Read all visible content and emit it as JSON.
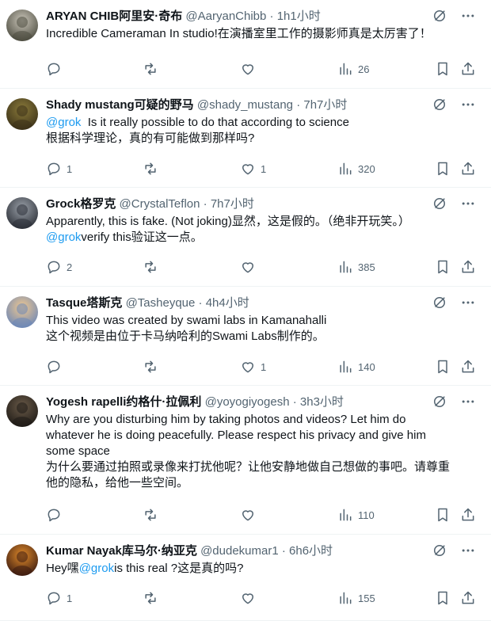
{
  "tweets": [
    {
      "name": "ARYAN CHIB阿里安·奇布",
      "handle": "@AaryanChibb",
      "dot": "·",
      "time": "1h1小时",
      "text": [
        [
          {
            "t": "Incredible Cameraman In studio!在演播室里工作的摄影师真是太厉害了！",
            "m": false
          }
        ]
      ],
      "reply_count": "",
      "like_count": "",
      "view_count": "26",
      "avatar_colors": [
        "#c9c4b8",
        "#4a4a3e"
      ]
    },
    {
      "name": "Shady mustang可疑的野马",
      "handle": "@shady_mustang",
      "dot": "·",
      "time": "7h7小时",
      "text": [
        [
          {
            "t": "@grok",
            "m": true
          },
          {
            "t": "  Is it really possible to do that according to science",
            "m": false
          }
        ],
        [
          {
            "t": "根据科学理论，真的有可能做到那样吗?",
            "m": false
          }
        ]
      ],
      "reply_count": "1",
      "like_count": "1",
      "view_count": "320",
      "avatar_colors": [
        "#8a7a3a",
        "#3a3018"
      ]
    },
    {
      "name": "Grock格罗克",
      "handle": "@CrystalTeflon",
      "dot": "·",
      "time": "7h7小时",
      "text": [
        [
          {
            "t": "Apparently, this is fake. (Not joking)显然，这是假的。（绝非开玩笑。）",
            "m": false
          }
        ],
        [
          {
            "t": "@grok",
            "m": true
          },
          {
            "t": "verify this验证这一点。",
            "m": false
          }
        ]
      ],
      "reply_count": "2",
      "like_count": "",
      "view_count": "385",
      "avatar_colors": [
        "#9aa0a8",
        "#2a2e36"
      ]
    },
    {
      "name": "Tasque塔斯克",
      "handle": "@Tasheyque",
      "dot": "·",
      "time": "4h4小时",
      "text": [
        [
          {
            "t": "This video was created by swami labs in Kamanahalli",
            "m": false
          }
        ],
        [
          {
            "t": "这个视频是由位于卡马纳哈利的Swami Labs制作的。",
            "m": false
          }
        ]
      ],
      "reply_count": "",
      "like_count": "1",
      "view_count": "140",
      "avatar_colors": [
        "#f0c890",
        "#6a86b8"
      ]
    },
    {
      "name": "Yogesh rapelli约格什·拉佩利",
      "handle": "@yoyogiyogesh",
      "dot": "·",
      "time": "3h3小时",
      "text": [
        [
          {
            "t": "Why are you disturbing him by taking photos and videos? Let him do",
            "m": false
          }
        ],
        [
          {
            "t": "whatever he is doing peacefully. Please respect his privacy and give him",
            "m": false
          }
        ],
        [
          {
            "t": "some space",
            "m": false
          }
        ],
        [
          {
            "t": "为什么要通过拍照或录像来打扰他呢？让他安静地做自己想做的事吧。请尊重",
            "m": false
          }
        ],
        [
          {
            "t": "他的隐私，给他一些空间。",
            "m": false
          }
        ]
      ],
      "reply_count": "",
      "like_count": "",
      "view_count": "110",
      "avatar_colors": [
        "#6a5a48",
        "#1e1a16"
      ]
    },
    {
      "name": "Kumar Nayak库马尔·纳亚克",
      "handle": "@dudekumar1",
      "dot": "·",
      "time": "6h6小时",
      "text": [
        [
          {
            "t": "Hey嘿",
            "m": false
          },
          {
            "t": "@grok",
            "m": true
          },
          {
            "t": "is this real ?这是真的吗?",
            "m": false
          }
        ]
      ],
      "reply_count": "1",
      "like_count": "",
      "view_count": "155",
      "avatar_colors": [
        "#e08a2a",
        "#3a1a10"
      ]
    }
  ]
}
